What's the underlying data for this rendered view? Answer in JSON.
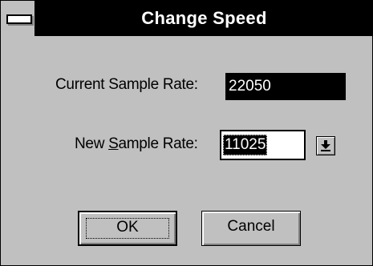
{
  "window": {
    "title": "Change Speed"
  },
  "current_rate": {
    "label": "Current Sample Rate:",
    "value": "22050"
  },
  "new_rate": {
    "label_pre": "New ",
    "label_mnemonic": "S",
    "label_post": "ample Rate:",
    "value": "11025"
  },
  "buttons": {
    "ok_label": "OK",
    "cancel_label": "Cancel"
  },
  "icons": {
    "system_menu": "system-menu-icon",
    "dropdown": "dropdown-arrow-icon"
  },
  "colors": {
    "face": "#c0c0c0",
    "titlebar": "#000000",
    "selection": "#000000"
  }
}
